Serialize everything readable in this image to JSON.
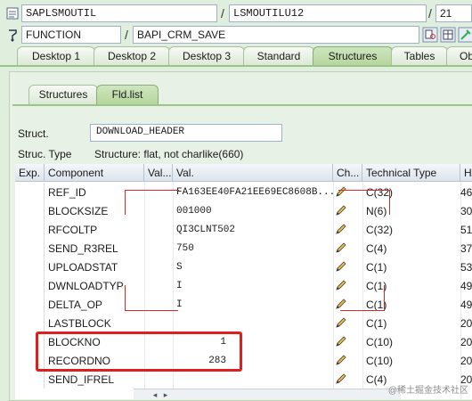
{
  "header": {
    "program_field": "SAPLSMOUTIL",
    "include_field": "LSMOUTILU12",
    "line_field": "21",
    "type_field": "FUNCTION",
    "name_field": "BAPI_CRM_SAVE"
  },
  "tabs": [
    "Desktop 1",
    "Desktop 2",
    "Desktop 3",
    "Standard",
    "Structures",
    "Tables",
    "Ob"
  ],
  "active_tab": "Structures",
  "subtabs": [
    "Structures",
    "Fld.list"
  ],
  "active_subtab": "Fld.list",
  "struct": {
    "label": "Struct.",
    "value": "DOWNLOAD_HEADER",
    "type_label": "Struc. Type",
    "type_value": "Structure: flat, not charlike(660)"
  },
  "grid": {
    "columns": [
      "Exp.",
      "Component",
      "Val...",
      "Val.",
      "Ch...",
      "Technical Type",
      "He"
    ],
    "rows": [
      {
        "component": "REF_ID",
        "value": "FA163EE40FA21EE69EC8608B...",
        "type": "C(32)",
        "he": "46"
      },
      {
        "component": "BLOCKSIZE",
        "value": "001000",
        "type": "N(6)",
        "he": "30"
      },
      {
        "component": "RFCOLTP",
        "value": "QI3CLNT502",
        "type": "C(32)",
        "he": "51"
      },
      {
        "component": "SEND_R3REL",
        "value": "750",
        "type": "C(4)",
        "he": "37"
      },
      {
        "component": "UPLOADSTAT",
        "value": "S",
        "type": "C(1)",
        "he": "53"
      },
      {
        "component": "DWNLOADTYP",
        "value": "I",
        "type": "C(1)",
        "he": "49"
      },
      {
        "component": "DELTA_OP",
        "value": "I",
        "type": "C(1)",
        "he": "49"
      },
      {
        "component": "LASTBLOCK",
        "value": "",
        "type": "C(1)",
        "he": "20"
      },
      {
        "component": "BLOCKNO",
        "value": "1",
        "type": "C(10)",
        "he": "20"
      },
      {
        "component": "RECORDNO",
        "value": "283",
        "type": "C(10)",
        "he": "20"
      },
      {
        "component": "SEND_IFREL",
        "value": "",
        "type": "C(4)",
        "he": "20"
      }
    ]
  },
  "watermark": "@稀土掘金技术社区",
  "colors": {
    "highlight_box": "#e01e1e",
    "active_tab": "#b5d59c"
  }
}
